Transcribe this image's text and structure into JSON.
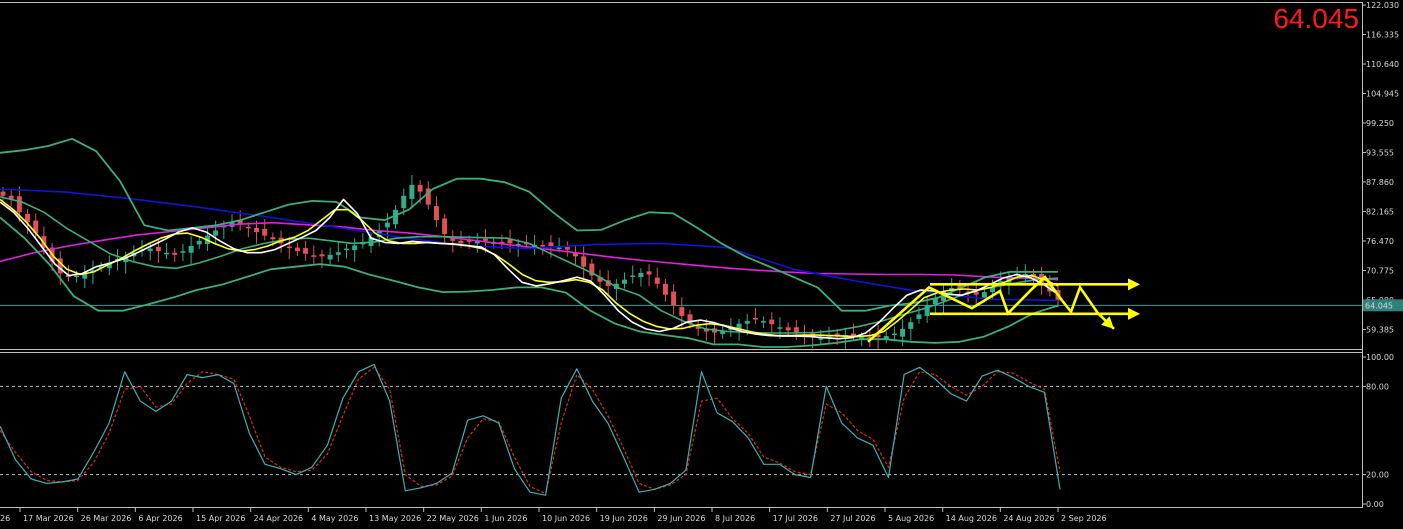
{
  "big_price": "64.045",
  "chart_data": [
    {
      "type": "candlestick",
      "x_labels": [
        "17 Mar 2026",
        "26 Mar 2026",
        "6 Apr 2026",
        "15 Apr 2026",
        "24 Apr 2026",
        "4 May 2026",
        "13 May 2026",
        "22 May 2026",
        "1 Jun 2026",
        "10 Jun 2026",
        "19 Jun 2026",
        "29 Jun 2026",
        "8 Jul 2026",
        "17 Jul 2026",
        "27 Jul 2026",
        "5 Aug 2026",
        "14 Aug 2026",
        "24 Aug 2026",
        "2 Sep 2026"
      ],
      "x_label_partial": "26",
      "y_ticks": [
        "122.030",
        "116.335",
        "110.640",
        "104.945",
        "99.250",
        "93.555",
        "87.860",
        "82.165",
        "76.470",
        "70.775",
        "65.080",
        "59.385"
      ],
      "ylim": [
        56.0,
        122.03
      ],
      "last_price": "64.045",
      "current_price_line": 64.045,
      "candles_close": [
        85.2,
        84.5,
        82.0,
        80.1,
        78.0,
        75.2,
        72.5,
        70.2,
        69.5,
        69.8,
        70.4,
        70.8,
        71.5,
        72.3,
        73.0,
        73.5,
        74.2,
        74.8,
        75.0,
        74.5,
        74.2,
        73.8,
        74.5,
        75.5,
        76.5,
        77.5,
        78.5,
        79.5,
        80.2,
        79.8,
        79.0,
        78.2,
        77.5,
        76.8,
        76.0,
        75.2,
        74.5,
        74.0,
        73.6,
        73.5,
        73.8,
        74.3,
        75.0,
        75.6,
        76.1,
        77.2,
        78.5,
        80.0,
        82.5,
        85.2,
        87.3,
        86.0,
        83.5,
        80.5,
        77.8,
        76.5,
        76.0,
        76.3,
        76.6,
        76.5,
        76.3,
        76.2,
        76.0,
        75.9,
        75.8,
        75.7,
        75.6,
        75.5,
        75.2,
        74.8,
        73.5,
        71.5,
        69.8,
        68.6,
        67.8,
        68.2,
        69.0,
        69.8,
        70.3,
        70.0,
        68.2,
        66.1,
        64.0,
        62.0,
        60.5,
        59.5,
        59.0,
        58.8,
        59.0,
        59.6,
        60.5,
        61.0,
        61.3,
        61.0,
        60.4,
        59.8,
        59.2,
        58.7,
        58.3,
        58.0,
        57.9,
        58.0,
        58.2,
        58.3,
        58.1,
        57.9,
        57.8,
        57.9,
        58.1,
        58.6,
        59.5,
        60.8,
        62.3,
        64.0,
        65.5,
        66.8,
        67.4,
        67.0,
        66.4,
        66.1,
        66.6,
        67.6,
        68.7,
        69.6,
        70.1,
        70.1,
        69.5,
        68.3,
        66.7,
        65.0
      ],
      "series": [
        {
          "name": "",
          "kind": "ma-blue",
          "color": "#0e14d8",
          "values": [
            86.5,
            85.9,
            84.6,
            83.0,
            81.2,
            79.3,
            77.3,
            75.6,
            75.0,
            75.8,
            76.0,
            75.2,
            71.0,
            68.6,
            66.5,
            65.2,
            65.0
          ]
        },
        {
          "name": "",
          "kind": "ma-magenta",
          "color": "#e31ee3",
          "values": [
            72.5,
            74.2,
            75.5,
            76.6,
            77.6,
            78.3,
            79.0,
            79.7,
            80.0,
            79.6,
            79.2,
            78.5,
            78.0,
            77.3,
            76.5,
            75.7,
            74.9,
            74.1,
            73.3,
            72.6,
            72.0,
            71.4,
            70.9,
            70.5,
            70.2,
            70.1,
            70.0,
            70.0,
            69.9,
            69.5,
            69.3,
            69.0
          ]
        },
        {
          "name": "",
          "kind": "bollinger-upper",
          "color": "#3ab07a",
          "values": [
            93.5,
            94.0,
            94.8,
            96.2,
            93.8,
            88.0,
            79.5,
            78.5,
            79.0,
            79.5,
            80.5,
            82.0,
            83.5,
            84.2,
            84.0,
            81.0,
            80.5,
            82.5,
            86.5,
            88.5,
            88.5,
            87.8,
            86.0,
            82.0,
            78.5,
            78.6,
            80.5,
            82.0,
            81.8,
            79.0,
            76.0,
            73.5,
            71.5,
            69.5,
            67.5,
            63.0,
            63.0,
            64.0,
            64.5,
            65.5,
            67.5,
            69.5,
            70.5,
            70.5,
            70.5
          ]
        },
        {
          "name": "",
          "kind": "bollinger-mid",
          "color": "#3ab07a",
          "values": [
            85.0,
            84.0,
            82.0,
            79.0,
            76.5,
            74.0,
            72.5,
            71.5,
            71.2,
            72.2,
            73.5,
            75.0,
            76.0,
            76.8,
            77.0,
            76.5,
            76.0,
            76.3,
            77.0,
            77.3,
            77.3,
            77.2,
            77.1,
            77.0,
            76.0,
            74.0,
            72.0,
            70.0,
            67.5,
            66.0,
            63.0,
            61.0,
            59.5,
            59.0,
            58.8,
            58.7,
            58.7,
            58.8,
            59.2,
            60.0,
            61.0,
            62.3,
            63.5,
            65.0,
            66.6,
            67.5,
            68.3,
            69.0,
            69.3
          ]
        },
        {
          "name": "",
          "kind": "bollinger-lower",
          "color": "#3ab07a",
          "values": [
            81.0,
            77.0,
            72.0,
            65.8,
            63.0,
            63.0,
            64.2,
            65.5,
            67.0,
            68.0,
            69.5,
            71.0,
            71.5,
            72.0,
            71.5,
            70.0,
            68.8,
            67.5,
            66.6,
            66.7,
            67.0,
            67.5,
            67.5,
            66.5,
            63.0,
            60.5,
            59.0,
            58.3,
            57.7,
            56.5,
            56.5,
            56.0,
            56.0,
            56.3,
            56.8,
            57.5,
            57.5,
            57.0,
            56.8,
            57.0,
            58.0,
            60.0,
            62.5,
            64.0
          ]
        },
        {
          "name": "",
          "kind": "ma-yellow",
          "color": "#ffff1e",
          "values": [
            84.5,
            82.5,
            80.0,
            77.0,
            73.5,
            71.0,
            70.0,
            70.5,
            71.8,
            73.0,
            74.5,
            75.8,
            77.0,
            77.8,
            78.0,
            77.2,
            76.0,
            75.0,
            74.5,
            74.8,
            75.5,
            76.5,
            77.2,
            78.5,
            80.5,
            82.5,
            82.5,
            80.5,
            78.0,
            76.5,
            76.0,
            76.0,
            76.2,
            76.0,
            75.8,
            75.5,
            75.0,
            73.8,
            72.0,
            70.0,
            68.8,
            68.5,
            68.6,
            69.0,
            68.5,
            67.0,
            64.5,
            62.5,
            61.0,
            60.0,
            59.5,
            59.6,
            60.2,
            60.5,
            60.2,
            59.6,
            59.0,
            58.5,
            58.2,
            58.2,
            58.3,
            58.3,
            58.2,
            58.1,
            58.0,
            58.2,
            59.0,
            61.0,
            63.2,
            65.5,
            66.5,
            67.0,
            67.2,
            67.0,
            67.5,
            68.5,
            69.5,
            69.8,
            69.0,
            67.8
          ]
        },
        {
          "name": "",
          "kind": "ma-white",
          "color": "#ffffff",
          "values": [
            84.0,
            82.0,
            79.0,
            75.5,
            72.0,
            69.8,
            70.2,
            71.5,
            72.2,
            73.0,
            74.2,
            75.5,
            76.8,
            78.2,
            79.0,
            78.2,
            76.5,
            75.0,
            74.2,
            74.2,
            74.8,
            76.0,
            77.2,
            78.5,
            81.0,
            84.5,
            81.8,
            77.0,
            76.2,
            76.0,
            76.4,
            76.2,
            76.0,
            75.9,
            75.6,
            75.3,
            73.8,
            71.0,
            68.5,
            67.8,
            68.2,
            68.8,
            69.5,
            68.7,
            66.0,
            63.0,
            60.8,
            59.5,
            59.0,
            59.6,
            60.8,
            61.2,
            60.7,
            59.8,
            59.0,
            58.5,
            58.2,
            58.1,
            58.1,
            58.0,
            57.8,
            57.6,
            57.8,
            58.7,
            60.8,
            63.5,
            66.0,
            67.0,
            66.8,
            66.2,
            66.0,
            66.8,
            68.0,
            69.3,
            70.0,
            69.4,
            68.0,
            66.2
          ]
        }
      ],
      "annotations": [
        {
          "kind": "zigzag-arrow",
          "color": "#ffff00",
          "points": [
            [
              57.0
            ],
            [
              67.5
            ],
            [
              63.5
            ],
            [
              66.8
            ],
            [
              62.5
            ],
            [
              67.2
            ],
            [
              69.5
            ],
            [
              65.0
            ],
            [
              62.8
            ],
            [
              67.5
            ],
            [
              62.5
            ],
            [
              59.5
            ]
          ]
        },
        {
          "kind": "horizontal-arrow",
          "color": "#ffff00",
          "value": 68.1
        },
        {
          "kind": "horizontal-arrow",
          "color": "#ffff00",
          "value": 62.4
        }
      ]
    },
    {
      "type": "line",
      "indicator": "stochastic",
      "y_ticks": [
        "100.00",
        "80.00",
        "20.00",
        "0.00"
      ],
      "ylim": [
        0,
        100
      ],
      "levels": [
        80,
        20
      ],
      "series": [
        {
          "name": "",
          "kind": "main",
          "color": "#3cb2b4",
          "values": [
            53,
            30,
            17,
            14,
            15,
            17,
            35,
            55,
            90,
            70,
            63,
            70,
            88,
            86,
            88,
            82,
            48,
            27,
            24,
            20,
            25,
            40,
            72,
            90,
            95,
            70,
            9,
            11,
            14,
            21,
            57,
            60,
            55,
            24,
            8,
            6,
            72,
            92,
            70,
            55,
            32,
            8,
            10,
            14,
            23,
            90,
            62,
            56,
            45,
            27,
            27,
            20,
            18,
            80,
            55,
            45,
            40,
            18,
            88,
            93,
            85,
            75,
            70,
            87,
            91,
            86,
            80,
            76,
            10
          ]
        },
        {
          "name": "",
          "kind": "signal",
          "color": "#e02828",
          "values": [
            50,
            35,
            22,
            16,
            15,
            16,
            28,
            48,
            78,
            80,
            66,
            68,
            82,
            90,
            88,
            85,
            60,
            32,
            25,
            22,
            23,
            34,
            60,
            85,
            93,
            78,
            20,
            12,
            13,
            19,
            45,
            58,
            56,
            32,
            12,
            7,
            55,
            88,
            78,
            60,
            38,
            14,
            10,
            13,
            20,
            70,
            72,
            58,
            48,
            32,
            28,
            22,
            20,
            68,
            62,
            50,
            44,
            25,
            72,
            90,
            88,
            80,
            74,
            80,
            90,
            89,
            83,
            78,
            22
          ]
        }
      ]
    }
  ]
}
